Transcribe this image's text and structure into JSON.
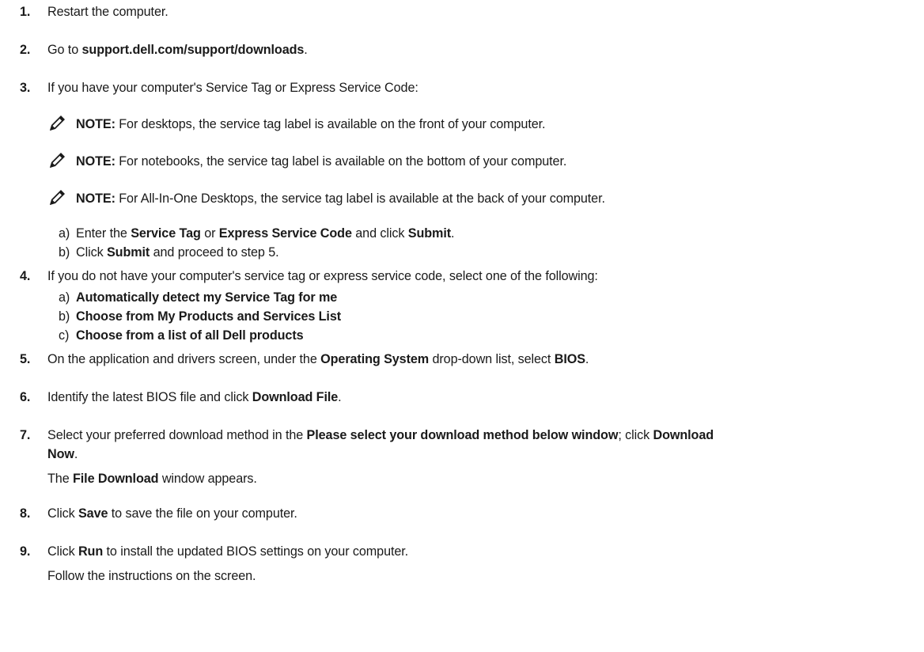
{
  "steps": [
    {
      "num": "1.",
      "parts": [
        {
          "t": "Restart the computer."
        }
      ]
    },
    {
      "num": "2.",
      "parts": [
        {
          "t": "Go to "
        },
        {
          "b": "support.dell.com/support/downloads"
        },
        {
          "t": "."
        }
      ]
    },
    {
      "num": "3.",
      "parts": [
        {
          "t": "If you have your computer's Service Tag or Express Service Code:"
        }
      ]
    },
    {
      "num": "4.",
      "parts": [
        {
          "t": "If you do not have your computer's service tag or express service code, select one of the following:"
        }
      ]
    },
    {
      "num": "5.",
      "parts": [
        {
          "t": "On the application and drivers screen, under the "
        },
        {
          "b": "Operating System"
        },
        {
          "t": " drop-down list, select "
        },
        {
          "b": "BIOS"
        },
        {
          "t": "."
        }
      ]
    },
    {
      "num": "6.",
      "parts": [
        {
          "t": "Identify the latest BIOS file and click "
        },
        {
          "b": "Download File"
        },
        {
          "t": "."
        }
      ]
    },
    {
      "num": "7.",
      "parts": [
        {
          "t": "Select your preferred download method in the "
        },
        {
          "b": "Please select your download method below window"
        },
        {
          "t": "; click "
        },
        {
          "b": "Download"
        }
      ]
    },
    {
      "num": "8.",
      "parts": [
        {
          "t": "Click "
        },
        {
          "b": "Save"
        },
        {
          "t": " to save the file on your computer."
        }
      ]
    },
    {
      "num": "9.",
      "parts": [
        {
          "t": "Click "
        },
        {
          "b": "Run"
        },
        {
          "t": " to install the updated BIOS settings on your computer."
        }
      ]
    }
  ],
  "notes": [
    {
      "label": "NOTE:",
      "text": " For desktops, the service tag label is available on the front of your computer."
    },
    {
      "label": "NOTE:",
      "text": " For notebooks, the service tag label is available on the bottom of your computer."
    },
    {
      "label": "NOTE:",
      "text": " For All-In-One Desktops, the service tag label is available at the back of your computer."
    }
  ],
  "substeps3": [
    {
      "letter": "a)",
      "parts": [
        {
          "t": "Enter the "
        },
        {
          "b": "Service Tag"
        },
        {
          "t": " or "
        },
        {
          "b": "Express Service Code"
        },
        {
          "t": " and click "
        },
        {
          "b": "Submit"
        },
        {
          "t": "."
        }
      ]
    },
    {
      "letter": "b)",
      "parts": [
        {
          "t": "Click "
        },
        {
          "b": "Submit"
        },
        {
          "t": " and proceed to step 5."
        }
      ]
    }
  ],
  "substeps4": [
    {
      "letter": "a)",
      "parts": [
        {
          "b": "Automatically detect my Service Tag for me"
        }
      ]
    },
    {
      "letter": "b)",
      "parts": [
        {
          "b": "Choose from My Products and Services List"
        }
      ]
    },
    {
      "letter": "c)",
      "parts": [
        {
          "b": "Choose from a list of all Dell products"
        }
      ]
    }
  ],
  "step7_cont": [
    {
      "b": "Now"
    },
    {
      "t": "."
    }
  ],
  "step7_result": [
    {
      "t": "The "
    },
    {
      "b": "File Download"
    },
    {
      "t": " window appears."
    }
  ],
  "step9_result": [
    {
      "t": "Follow the instructions on the screen."
    }
  ],
  "note_icon": "pencil-note-icon"
}
